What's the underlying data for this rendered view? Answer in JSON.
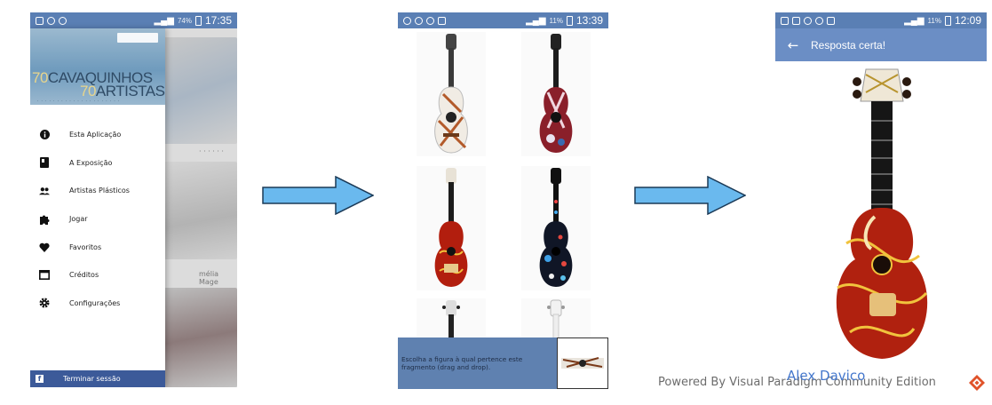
{
  "screens": [
    {
      "status": {
        "battery": "74%",
        "time": "17:35"
      },
      "header": {
        "num1": "70",
        "word1": "CAVAQUINHOS",
        "num2": "70",
        "word2": "ARTISTAS"
      },
      "menu": [
        {
          "label": "Esta Aplicação",
          "icon": "info-icon"
        },
        {
          "label": "A Exposição",
          "icon": "book-icon"
        },
        {
          "label": "Artistas Plásticos",
          "icon": "people-icon"
        },
        {
          "label": "Jogar",
          "icon": "puzzle-icon"
        },
        {
          "label": "Favoritos",
          "icon": "heart-icon"
        },
        {
          "label": "Créditos",
          "icon": "window-icon"
        },
        {
          "label": "Configurações",
          "icon": "gear-icon"
        }
      ],
      "logout": "Terminar sessão",
      "background_caption": "mélia Mage"
    },
    {
      "status": {
        "battery": "11%",
        "time": "13:39"
      },
      "instruction": "Escolha a figura à qual pertence este fragmento (drag and drop)."
    },
    {
      "status": {
        "battery": "11%",
        "time": "12:09"
      },
      "title": "Resposta certa!"
    }
  ],
  "footer": {
    "watermark": "Powered By Visual Paradigm Community Edition",
    "author": "Alex Davico"
  },
  "colors": {
    "status_bar": "#5a7fb4",
    "app_bar": "#6b8ec5",
    "arrow_fill": "#6ab9ee",
    "logout_bar": "#3c5a99"
  }
}
